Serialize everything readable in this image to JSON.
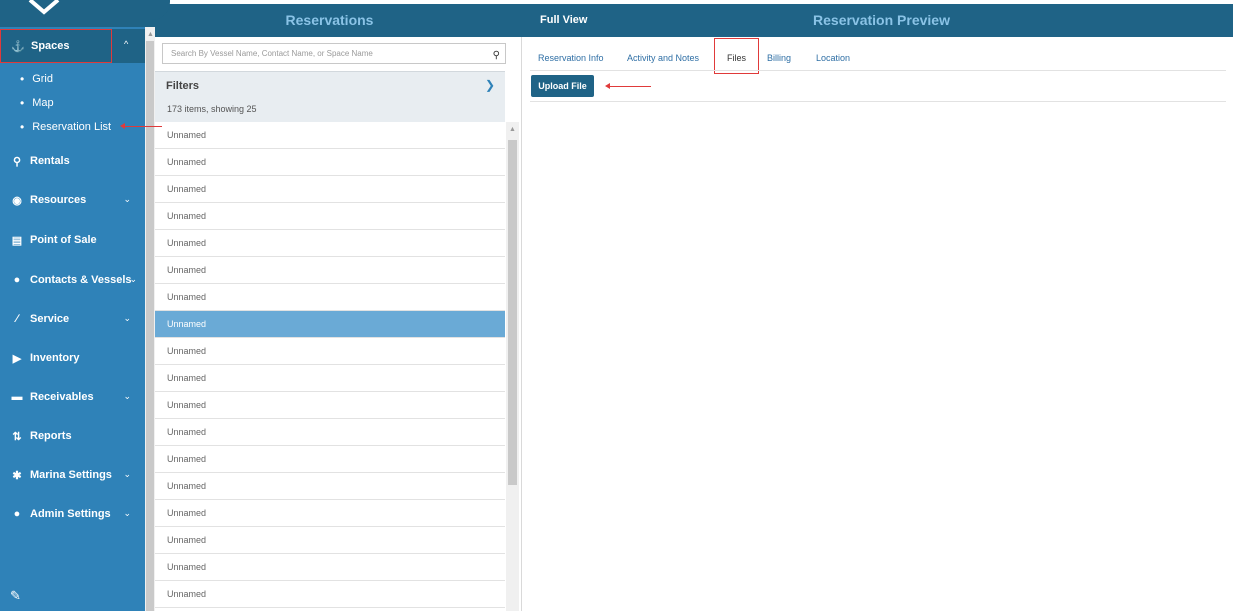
{
  "header": {
    "reservations_title": "Reservations",
    "full_view": "Full View",
    "preview_title": "Reservation Preview"
  },
  "sidebar": {
    "spaces": {
      "label": "Spaces",
      "chev": "^"
    },
    "sub_items": [
      "Grid",
      "Map",
      "Reservation List"
    ],
    "items": [
      {
        "label": "Rentals",
        "icon": "⚖",
        "has_chevron": false
      },
      {
        "label": "Resources",
        "icon": "◉",
        "has_chevron": true
      },
      {
        "label": "Point of Sale",
        "icon": "▤",
        "has_chevron": false
      },
      {
        "label": "Contacts & Vessels",
        "icon": "●",
        "has_chevron": true
      },
      {
        "label": "Service",
        "icon": "∕",
        "has_chevron": true
      },
      {
        "label": "Inventory",
        "icon": "▶",
        "has_chevron": false
      },
      {
        "label": "Receivables",
        "icon": "▬",
        "has_chevron": true
      },
      {
        "label": "Reports",
        "icon": "↓",
        "has_chevron": false
      },
      {
        "label": "Marina Settings",
        "icon": "✱",
        "has_chevron": true
      },
      {
        "label": "Admin Settings",
        "icon": "●",
        "has_chevron": true
      }
    ],
    "chevron": "⌄"
  },
  "search": {
    "placeholder": "Search By Vessel Name, Contact Name, or Space Name"
  },
  "filters": {
    "label": "Filters",
    "count_text": "173 items, showing 25"
  },
  "list": {
    "rows": [
      "Unnamed",
      "Unnamed",
      "Unnamed",
      "Unnamed",
      "Unnamed",
      "Unnamed",
      "Unnamed",
      "Unnamed",
      "Unnamed",
      "Unnamed",
      "Unnamed",
      "Unnamed",
      "Unnamed",
      "Unnamed",
      "Unnamed",
      "Unnamed",
      "Unnamed",
      "Unnamed"
    ],
    "selected_index": 7
  },
  "tabs": {
    "items": [
      "Reservation Info",
      "Activity and Notes",
      "Files",
      "Billing",
      "Location"
    ],
    "active_index": 2
  },
  "upload": {
    "label": "Upload File"
  },
  "colors": {
    "header_bg": "#1f6386",
    "sidebar_bg": "#2f82b8",
    "selected_row": "#6aaad6",
    "annotation_red": "#e03a3a"
  }
}
